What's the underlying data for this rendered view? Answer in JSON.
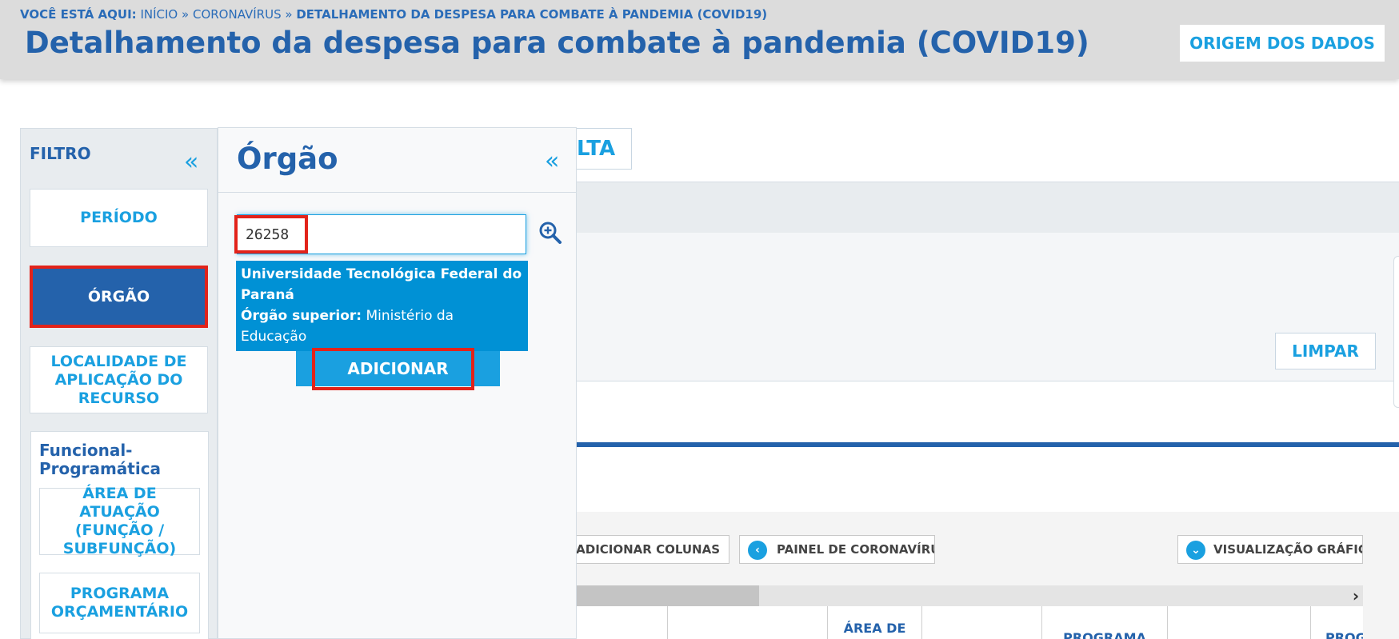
{
  "breadcrumb": {
    "prefix": "VOCÊ ESTÁ AQUI:",
    "home": "INÍCIO",
    "sep1": "»",
    "section": "CORONAVÍRUS",
    "sep2": "»",
    "current": "DETALHAMENTO DA DESPESA PARA COMBATE À PANDEMIA (COVID19)"
  },
  "header": {
    "title": "Detalhamento da despesa para combate à pandemia (COVID19)",
    "origem_label": "ORIGEM DOS DADOS"
  },
  "filter": {
    "title": "FILTRO",
    "collapse_icon": "«",
    "items": {
      "periodo": "PERÍODO",
      "orgao": "ÓRGÃO",
      "localidade": "LOCALIDADE DE APLICAÇÃO DO RECURSO"
    },
    "funcional": {
      "title": "Funcional-Programática",
      "area": "ÁREA DE ATUAÇÃO (FUNÇÃO / SUBFUNÇÃO)",
      "programa": "PROGRAMA ORÇAMENTÁRIO"
    }
  },
  "orgao_panel": {
    "title": "Órgão",
    "collapse_icon": "«",
    "search_value": "26258",
    "suggestion": {
      "name": "Universidade Tecnológica Federal do Paraná",
      "superior_label": "Órgão superior:",
      "superior_value": "Ministério da Educação"
    },
    "add_label": "ADICIONAR"
  },
  "background": {
    "consulta_fragment": "LTA",
    "limpar_label": "LIMPAR",
    "toolbar": {
      "columns_label": "ER/ADICIONAR COLUNAS",
      "painel_label": "PAINEL DE CORONAVÍRUS",
      "grafica_label": "VISUALIZAÇÃO GRÁFICA",
      "painel_icon": "chevron-left-icon",
      "grafica_icon": "chevron-down-icon"
    },
    "scroll_arrow": "›",
    "table_headers": [
      "ÁREA DE",
      "PROGRAMA",
      "PROGR"
    ]
  },
  "colors": {
    "primary_blue": "#2462ab",
    "accent_blue": "#1aa0e0",
    "highlight_red": "#e2231a",
    "header_gray": "#dcdcdc"
  }
}
